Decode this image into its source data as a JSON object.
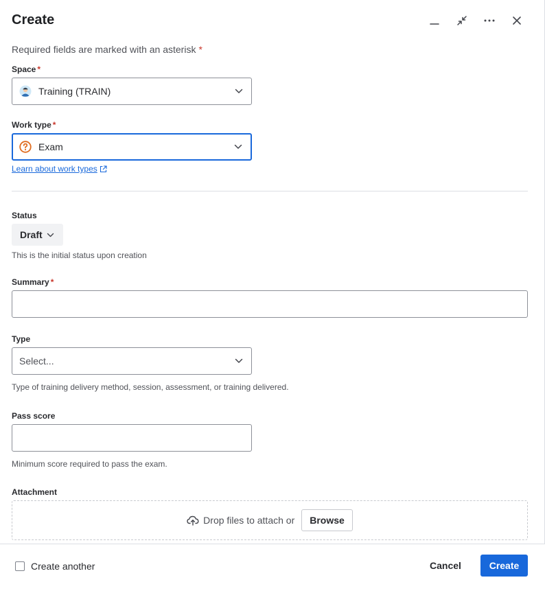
{
  "header": {
    "title": "Create",
    "icons": [
      "minimize-icon",
      "collapse-icon",
      "more-icon",
      "close-icon"
    ]
  },
  "form": {
    "required_note": "Required fields are marked with an asterisk",
    "asterisk": "*",
    "space": {
      "label": "Space",
      "value": "Training (TRAIN)",
      "icon": "space-avatar-icon"
    },
    "work_type": {
      "label": "Work type",
      "value": "Exam",
      "icon": "question-circle-icon",
      "link": "Learn about work types"
    },
    "status": {
      "label": "Status",
      "value": "Draft",
      "help": "This is the initial status upon creation"
    },
    "summary": {
      "label": "Summary",
      "value": ""
    },
    "type": {
      "label": "Type",
      "placeholder": "Select...",
      "help": "Type of training delivery method, session, assessment, or training delivered."
    },
    "pass_score": {
      "label": "Pass score",
      "value": "",
      "help": "Minimum score required to pass the exam."
    },
    "attachment": {
      "label": "Attachment",
      "drop_text": "Drop files to attach or",
      "browse_label": "Browse"
    }
  },
  "footer": {
    "create_another_label": "Create another",
    "cancel_label": "Cancel",
    "create_label": "Create"
  },
  "colors": {
    "accent": "#1868db",
    "required": "#c9372c",
    "work_type_icon": "#e06c1f"
  }
}
